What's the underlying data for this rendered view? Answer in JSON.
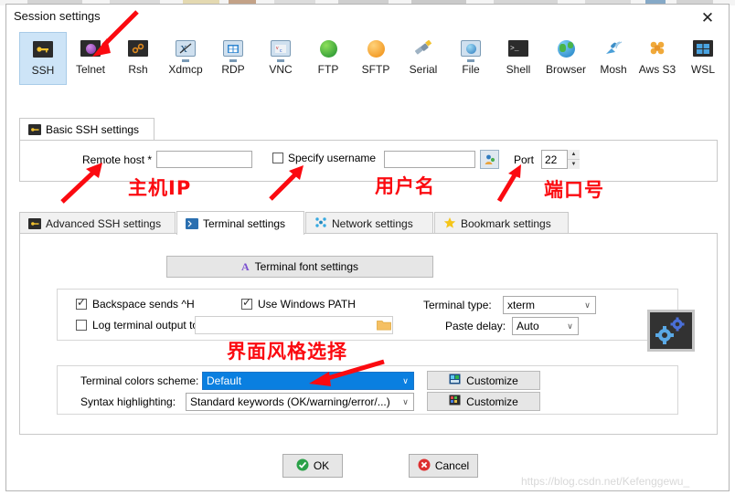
{
  "window": {
    "title": "Session settings",
    "close_label": "✕",
    "close_icon": "close-icon"
  },
  "protocols": [
    {
      "label": "SSH",
      "icon": "ssh-icon",
      "selected": true
    },
    {
      "label": "Telnet",
      "icon": "telnet-icon",
      "selected": false
    },
    {
      "label": "Rsh",
      "icon": "rsh-icon",
      "selected": false
    },
    {
      "label": "Xdmcp",
      "icon": "xdmcp-icon",
      "selected": false
    },
    {
      "label": "RDP",
      "icon": "rdp-icon",
      "selected": false
    },
    {
      "label": "VNC",
      "icon": "vnc-icon",
      "selected": false
    },
    {
      "label": "FTP",
      "icon": "ftp-icon",
      "selected": false
    },
    {
      "label": "SFTP",
      "icon": "sftp-icon",
      "selected": false
    },
    {
      "label": "Serial",
      "icon": "serial-icon",
      "selected": false
    },
    {
      "label": "File",
      "icon": "file-icon",
      "selected": false
    },
    {
      "label": "Shell",
      "icon": "shell-icon",
      "selected": false
    },
    {
      "label": "Browser",
      "icon": "browser-icon",
      "selected": false
    },
    {
      "label": "Mosh",
      "icon": "mosh-icon",
      "selected": false
    },
    {
      "label": "Aws S3",
      "icon": "aws-s3-icon",
      "selected": false
    },
    {
      "label": "WSL",
      "icon": "wsl-icon",
      "selected": false
    }
  ],
  "basic": {
    "tab_label": "Basic SSH settings",
    "tab_icon": "ssh-icon",
    "remote_host_label": "Remote host *",
    "remote_host_value": "",
    "specify_username_label": "Specify username",
    "specify_username_checked": false,
    "username_value": "",
    "user_picker_icon": "user-icon",
    "port_label": "Port",
    "port_value": "22",
    "spinner_icon": "spinner-updown-icon"
  },
  "lower_tabs": [
    {
      "label": "Advanced SSH settings",
      "icon": "ssh-icon",
      "active": false
    },
    {
      "label": "Terminal settings",
      "icon": "terminal-icon",
      "active": true
    },
    {
      "label": "Network settings",
      "icon": "network-icon",
      "active": false
    },
    {
      "label": "Bookmark settings",
      "icon": "star-icon",
      "active": false
    }
  ],
  "terminal": {
    "font_settings_label": "Terminal font settings",
    "font_settings_icon": "font-a-icon",
    "backspace_label": "Backspace sends ^H",
    "backspace_checked": true,
    "use_windows_path_label": "Use Windows PATH",
    "use_windows_path_checked": true,
    "log_output_label": "Log terminal output to:",
    "log_output_checked": false,
    "log_output_value": "",
    "folder_icon": "folder-icon",
    "terminal_type_label": "Terminal type:",
    "terminal_type_value": "xterm",
    "paste_delay_label": "Paste delay:",
    "paste_delay_value": "Auto",
    "colors_scheme_label": "Terminal colors scheme:",
    "colors_scheme_value": "Default",
    "colors_scheme_customize": "Customize",
    "colors_scheme_customize_icon": "palette-icon",
    "syntax_label": "Syntax highlighting:",
    "syntax_value": "Standard keywords (OK/warning/error/...)",
    "syntax_customize": "Customize",
    "syntax_customize_icon": "syntax-icon",
    "preview_icon": "gears-preview-icon"
  },
  "buttons": {
    "ok_label": "OK",
    "ok_icon": "check-circle-icon",
    "cancel_label": "Cancel",
    "cancel_icon": "cross-circle-icon"
  },
  "annotations": {
    "color": "#fb0a10",
    "notes": [
      {
        "text": "主机IP",
        "name": "annotation-remote-host"
      },
      {
        "text": "用户名",
        "name": "annotation-username"
      },
      {
        "text": "端口号",
        "name": "annotation-port"
      },
      {
        "text": "界面风格选择",
        "name": "annotation-color-scheme"
      }
    ]
  },
  "watermark": {
    "text": "https://blog.csdn.net/Kefenggewu_"
  }
}
